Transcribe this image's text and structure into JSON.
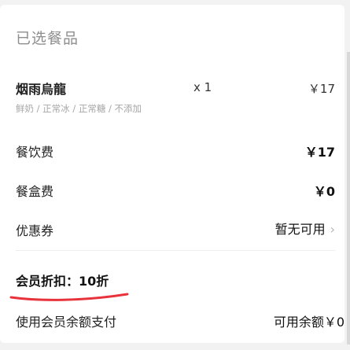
{
  "section": {
    "title": "已选餐品"
  },
  "item": {
    "name": "烟雨烏龍",
    "quantity": "x 1",
    "price": "￥17",
    "options": "鲜奶 / 正常冰 / 正常糖 / 不添加"
  },
  "fees": {
    "meal_label": "餐饮费",
    "meal_value": "￥17",
    "box_label": "餐盒费",
    "box_value": "￥0",
    "coupon_label": "优惠券",
    "coupon_value": "暂无可用"
  },
  "member": {
    "discount_label": "会员折扣：",
    "discount_value": "10折",
    "balance_label": "使用会员余额支付",
    "balance_value": "可用余额￥0"
  },
  "colors": {
    "annotation": "#e8323c"
  }
}
